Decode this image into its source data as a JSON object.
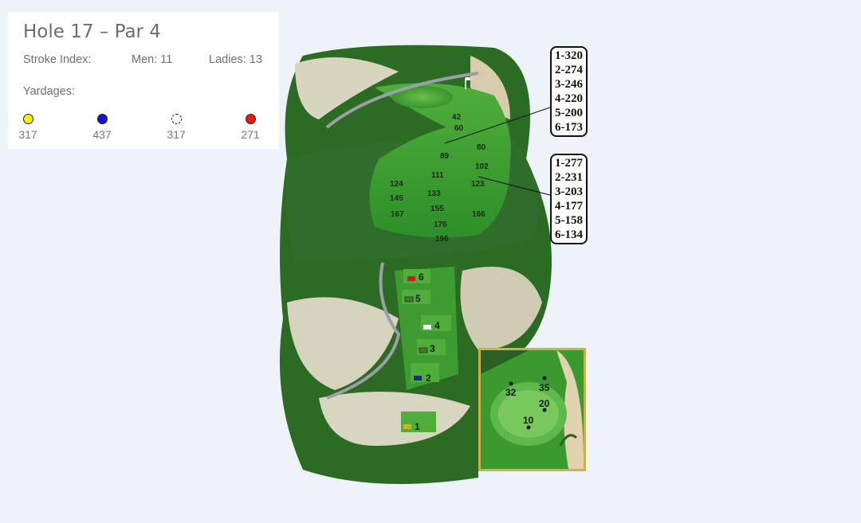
{
  "hole": {
    "title": "Hole 17 – Par 4",
    "stroke_index_label": "Stroke Index:",
    "men": "Men: 11",
    "ladies": "Ladies: 13",
    "yardages_label": "Yardages:"
  },
  "tees": [
    {
      "color": "#f5ef1c",
      "yards": "317"
    },
    {
      "color": "#1414d6",
      "yards": "437"
    },
    {
      "color": "#ffffff",
      "yards": "317"
    },
    {
      "color": "#e81b1b",
      "yards": "271"
    }
  ],
  "yardage_box_upper": [
    "1-320",
    "2-274",
    "3-246",
    "4-220",
    "5-200",
    "6-173"
  ],
  "yardage_box_lower": [
    "1-277",
    "2-231",
    "3-203",
    "4-177",
    "5-158",
    "6-134"
  ],
  "fairway_markers": [
    "42",
    "60",
    "80",
    "89",
    "102",
    "111",
    "123",
    "124",
    "133",
    "145",
    "155",
    "166",
    "167",
    "176",
    "196"
  ],
  "tee_box_numbers": [
    "6",
    "5",
    "4",
    "3",
    "2",
    "1"
  ],
  "green_pins": [
    "32",
    "35",
    "20",
    "10"
  ]
}
